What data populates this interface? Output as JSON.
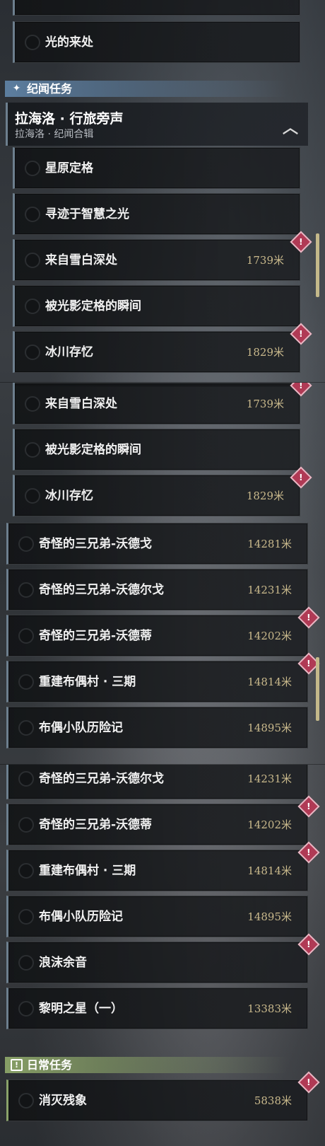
{
  "strip1": {
    "rows": [
      {
        "label": "光的来处"
      }
    ],
    "story_section": {
      "icon": "sparkle-icon",
      "label": "纪闻任务"
    },
    "group": {
      "title": "拉海洛 · 行旅旁声",
      "subtitle": "拉海洛 · 纪闻合辑",
      "icon": "chevron-up-icon"
    },
    "items": [
      {
        "label": "星原定格",
        "distance": "",
        "alert": false
      },
      {
        "label": "寻迹于智慧之光",
        "distance": "",
        "alert": false
      },
      {
        "label": "来自雪白深处",
        "distance": "1739米",
        "alert": true
      },
      {
        "label": "被光影定格的瞬间",
        "distance": "",
        "alert": false
      },
      {
        "label": "冰川存忆",
        "distance": "1829米",
        "alert": true
      }
    ]
  },
  "strip2": {
    "nested_items": [
      {
        "label": "来自雪白深处",
        "distance": "1739米",
        "alert": true
      },
      {
        "label": "被光影定格的瞬间",
        "distance": "",
        "alert": false
      },
      {
        "label": "冰川存忆",
        "distance": "1829米",
        "alert": true
      }
    ],
    "top_items": [
      {
        "label": "奇怪的三兄弟-沃德戈",
        "distance": "14281米",
        "alert": false
      },
      {
        "label": "奇怪的三兄弟-沃德尔戈",
        "distance": "14231米",
        "alert": false
      },
      {
        "label": "奇怪的三兄弟-沃德蒂",
        "distance": "14202米",
        "alert": true
      },
      {
        "label": "重建布偶村 · 三期",
        "distance": "14814米",
        "alert": true
      },
      {
        "label": "布偶小队历险记",
        "distance": "14895米",
        "alert": false
      }
    ]
  },
  "strip3": {
    "top_items": [
      {
        "label": "奇怪的三兄弟-沃德尔戈",
        "distance": "14231米",
        "alert": false
      },
      {
        "label": "奇怪的三兄弟-沃德蒂",
        "distance": "14202米",
        "alert": true
      },
      {
        "label": "重建布偶村 · 三期",
        "distance": "14814米",
        "alert": true
      },
      {
        "label": "布偶小队历险记",
        "distance": "14895米",
        "alert": false
      },
      {
        "label": "浪沫余音",
        "distance": "",
        "alert": true
      },
      {
        "label": "黎明之星（一）",
        "distance": "13383米",
        "alert": false
      }
    ],
    "daily_section": {
      "icon": "exclamation-box-icon",
      "label": "日常任务"
    },
    "daily_items": [
      {
        "label": "消灭残象",
        "distance": "5838米",
        "alert": true
      }
    ]
  },
  "colors": {
    "accent_blue": "#5f82a5",
    "accent_green": "#8ca569",
    "distance_gold": "#c9b98c",
    "alert_red": "#b03a55"
  }
}
